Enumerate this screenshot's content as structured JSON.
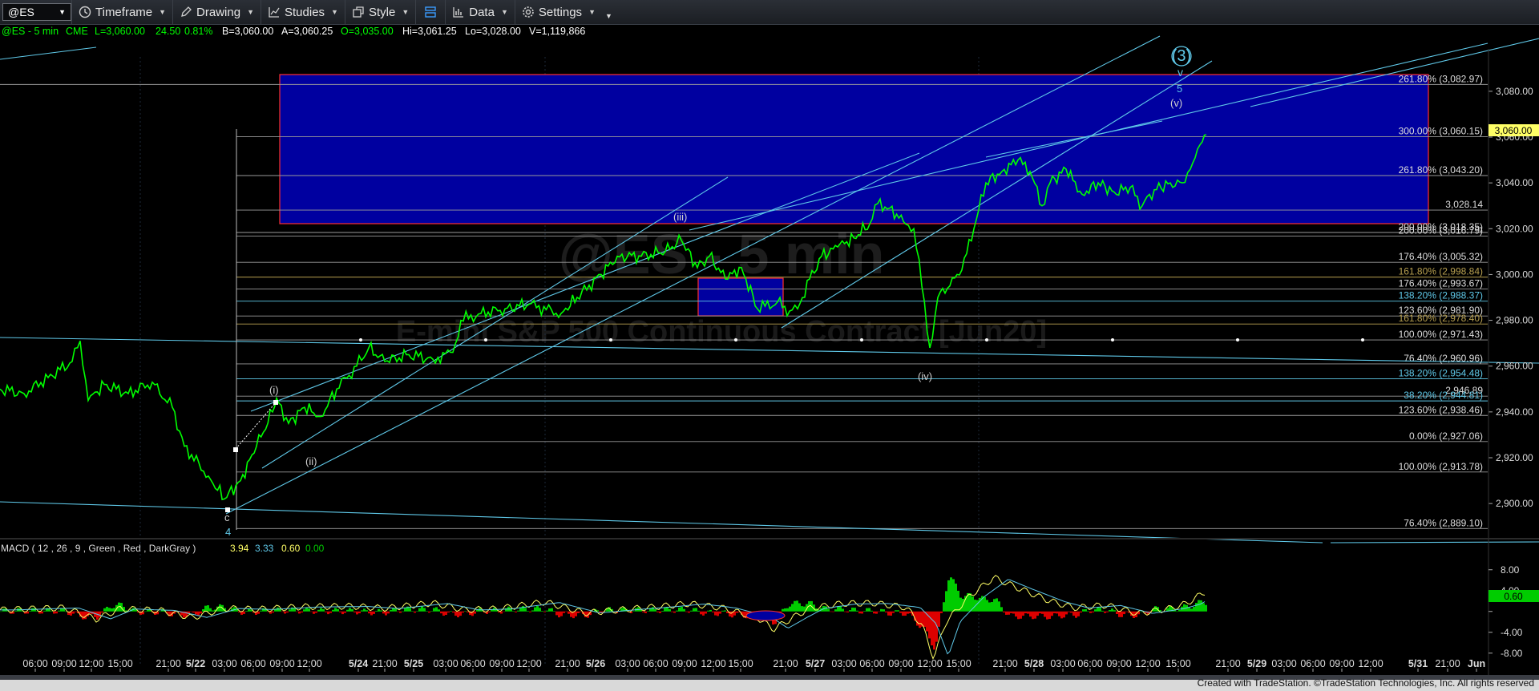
{
  "toolbar": {
    "symbol": "@ES",
    "items": [
      {
        "label": "Timeframe",
        "icon": "clock-icon"
      },
      {
        "label": "Drawing",
        "icon": "pencil-icon"
      },
      {
        "label": "Studies",
        "icon": "studies-icon"
      },
      {
        "label": "Style",
        "icon": "style-icon"
      },
      {
        "label": "",
        "icon": "layout-icon"
      },
      {
        "label": "Data",
        "icon": "data-icon"
      },
      {
        "label": "Settings",
        "icon": "gear-icon"
      }
    ]
  },
  "quote_line": {
    "symbol_text": "@ES - 5 min",
    "exchange": "CME",
    "last": "L=3,060.00",
    "change": "24.50",
    "pct": "0.81%",
    "bid": "B=3,060.00",
    "ask": "A=3,060.25",
    "open": "O=3,035.00",
    "high": "Hi=3,061.25",
    "low": "Lo=3,028.00",
    "volume": "V=1,119,866"
  },
  "watermark": {
    "line1": "E-mini S&P 500 Continuous Contract [Jun20]",
    "line2": "@ES - 5 min"
  },
  "macd_label": {
    "text": "MACD ( 12 , 26 , 9 , Green , Red , DarkGray )",
    "v1": "3.94",
    "v2": "3.33",
    "v3": "0.60",
    "v4": "0.00"
  },
  "footer": "Created with TradeStation. ©TradeStation Technologies, Inc. All rights reserved",
  "colors": {
    "price": "#00ff00",
    "box": "#0000a0",
    "box_border": "#ff3030",
    "channel": "#5fc8e8",
    "fib": "#9a9a9a",
    "macd_pos": "#00cc00",
    "macd_neg": "#dd0000",
    "macd_line": "#ffff66",
    "signal_line": "#5fc8e8",
    "last_price_tag": "#ffff66"
  },
  "chart_data": {
    "type": "line",
    "title": "@ES - 5 min",
    "ylim": [
      2885,
      3095
    ],
    "y_ticks": [
      "3,080.00",
      "3,060.00",
      "3,040.00",
      "3,020.00",
      "3,000.00",
      "2,980.00",
      "2,960.00",
      "2,940.00",
      "2,920.00",
      "2,900.00"
    ],
    "y_tick_values": [
      3080,
      3060,
      3040,
      3020,
      3000,
      2980,
      2960,
      2940,
      2920,
      2900
    ],
    "last_price_label": "3,060.00",
    "macd_ticks": [
      "8.00",
      "4.00",
      "0.00",
      "-4.00",
      "-8.00"
    ],
    "macd_tick_values": [
      8,
      4,
      0,
      -4,
      -8
    ],
    "macd_ylim": [
      -10.5,
      9.5
    ],
    "macd_label_tag": "0.60",
    "x_tick_labels": [
      "06:00",
      "09:00",
      "12:00",
      "15:00",
      "21:00",
      "5/22",
      "03:00",
      "06:00",
      "09:00",
      "12:00",
      "5/24",
      "21:00",
      "5/25",
      "03:00",
      "06:00",
      "09:00",
      "12:00",
      "21:00",
      "5/26",
      "03:00",
      "06:00",
      "09:00",
      "12:00",
      "15:00",
      "21:00",
      "5/27",
      "03:00",
      "06:00",
      "09:00",
      "12:00",
      "15:00",
      "21:00",
      "5/28",
      "03:00",
      "06:00",
      "09:00",
      "12:00",
      "15:00",
      "21:00",
      "5/29",
      "03:00",
      "06:00",
      "09:00",
      "12:00",
      "5/31",
      "21:00",
      "Jun"
    ],
    "fib_levels": [
      {
        "label": "261.80% (3,082.97)",
        "value": 3082.97
      },
      {
        "label": "300.00% (3,060.15)",
        "value": 3060.15
      },
      {
        "label": "261.80% (3,043.20)",
        "value": 3043.2
      },
      {
        "label": "3,028.14",
        "value": 3028.14
      },
      {
        "label": "200.00% (3,018.35)",
        "value": 3018.35
      },
      {
        "label": "200.00% (3,016.79)",
        "value": 3016.79
      },
      {
        "label": "176.40% (3,005.32)",
        "value": 3005.32
      },
      {
        "label": "161.80% (2,998.84)",
        "value": 2998.84
      },
      {
        "label": "176.40% (2,993.67)",
        "value": 2993.67
      },
      {
        "label": "138.20% (2,988.37)",
        "value": 2988.37
      },
      {
        "label": "123.60% (2,981.90)",
        "value": 2981.9
      },
      {
        "label": "161.80% (2,978.40)",
        "value": 2978.4
      },
      {
        "label": "100.00% (2,971.43)",
        "value": 2971.43
      },
      {
        "label": "76.40% (2,960.96)",
        "value": 2960.96
      },
      {
        "label": "138.20% (2,954.48)",
        "value": 2954.48
      },
      {
        "label": "2,946.89",
        "value": 2946.89
      },
      {
        "label": "38.20% (2,944.81)",
        "value": 2944.81
      },
      {
        "label": "123.60% (2,938.46)",
        "value": 2938.46
      },
      {
        "label": "0.00% (2,927.06)",
        "value": 2927.06
      },
      {
        "label": "100.00% (2,913.78)",
        "value": 2913.78
      },
      {
        "label": "76.40% (2,889.10)",
        "value": 2889.1
      }
    ],
    "price_path": [
      [
        0,
        2950
      ],
      [
        30,
        2948
      ],
      [
        60,
        2955
      ],
      [
        90,
        2962
      ],
      [
        100,
        2971
      ],
      [
        110,
        2945
      ],
      [
        130,
        2952
      ],
      [
        160,
        2948
      ],
      [
        190,
        2953
      ],
      [
        215,
        2942
      ],
      [
        230,
        2925
      ],
      [
        260,
        2912
      ],
      [
        280,
        2902
      ],
      [
        300,
        2910
      ],
      [
        320,
        2925
      ],
      [
        340,
        2940
      ],
      [
        345,
        2946
      ],
      [
        360,
        2935
      ],
      [
        380,
        2942
      ],
      [
        400,
        2938
      ],
      [
        420,
        2950
      ],
      [
        445,
        2960
      ],
      [
        460,
        2968
      ],
      [
        480,
        2962
      ],
      [
        510,
        2965
      ],
      [
        540,
        2963
      ],
      [
        565,
        2966
      ],
      [
        575,
        2980
      ],
      [
        600,
        2983
      ],
      [
        630,
        2985
      ],
      [
        660,
        2987
      ],
      [
        700,
        2983
      ],
      [
        720,
        2990
      ],
      [
        750,
        3000
      ],
      [
        770,
        3008
      ],
      [
        800,
        3008
      ],
      [
        830,
        3010
      ],
      [
        850,
        3015
      ],
      [
        870,
        3003
      ],
      [
        885,
        3008
      ],
      [
        905,
        2998
      ],
      [
        925,
        3003
      ],
      [
        945,
        2985
      ],
      [
        970,
        2988
      ],
      [
        985,
        2984
      ],
      [
        995,
        2985
      ],
      [
        1010,
        2998
      ],
      [
        1025,
        3008
      ],
      [
        1045,
        3012
      ],
      [
        1065,
        3016
      ],
      [
        1085,
        3022
      ],
      [
        1095,
        3031
      ],
      [
        1110,
        3029
      ],
      [
        1130,
        3022
      ],
      [
        1140,
        3020
      ],
      [
        1150,
        2995
      ],
      [
        1160,
        2968
      ],
      [
        1170,
        2990
      ],
      [
        1185,
        2995
      ],
      [
        1200,
        3002
      ],
      [
        1215,
        3020
      ],
      [
        1230,
        3040
      ],
      [
        1250,
        3045
      ],
      [
        1270,
        3050
      ],
      [
        1285,
        3045
      ],
      [
        1300,
        3030
      ],
      [
        1310,
        3040
      ],
      [
        1330,
        3046
      ],
      [
        1350,
        3035
      ],
      [
        1370,
        3040
      ],
      [
        1390,
        3036
      ],
      [
        1410,
        3038
      ],
      [
        1425,
        3030
      ],
      [
        1440,
        3037
      ],
      [
        1460,
        3040
      ],
      [
        1475,
        3040
      ],
      [
        1485,
        3046
      ],
      [
        1500,
        3058
      ],
      [
        1505,
        3061
      ]
    ],
    "macd_path": [
      [
        0,
        0.3
      ],
      [
        80,
        0.7
      ],
      [
        120,
        -1.5
      ],
      [
        150,
        0.5
      ],
      [
        200,
        0.2
      ],
      [
        240,
        -1.2
      ],
      [
        280,
        0.6
      ],
      [
        320,
        0.4
      ],
      [
        380,
        0.9
      ],
      [
        440,
        1.0
      ],
      [
        480,
        0.6
      ],
      [
        540,
        1.6
      ],
      [
        580,
        0.3
      ],
      [
        620,
        0.5
      ],
      [
        680,
        1.8
      ],
      [
        730,
        -0.3
      ],
      [
        780,
        0.4
      ],
      [
        820,
        0.9
      ],
      [
        860,
        1.5
      ],
      [
        900,
        0.7
      ],
      [
        945,
        -1.2
      ],
      [
        965,
        -3.4
      ],
      [
        990,
        -1.1
      ],
      [
        1010,
        0.6
      ],
      [
        1050,
        1.5
      ],
      [
        1090,
        1.6
      ],
      [
        1130,
        0.8
      ],
      [
        1150,
        -2.5
      ],
      [
        1165,
        -9.0
      ],
      [
        1180,
        -2.0
      ],
      [
        1210,
        3.0
      ],
      [
        1240,
        6.5
      ],
      [
        1270,
        4.5
      ],
      [
        1310,
        2.0
      ],
      [
        1340,
        0.7
      ],
      [
        1380,
        1.2
      ],
      [
        1420,
        -0.4
      ],
      [
        1460,
        0.6
      ],
      [
        1480,
        1.5
      ],
      [
        1505,
        3.9
      ]
    ],
    "annotations": [
      {
        "text": "(3)",
        "kind": "circled"
      },
      {
        "text": "5"
      },
      {
        "text": "(v)"
      },
      {
        "text": "(iii)"
      },
      {
        "text": "(iv)"
      },
      {
        "text": "(i)"
      },
      {
        "text": "(ii)"
      },
      {
        "text": "c"
      },
      {
        "text": "4"
      }
    ]
  }
}
